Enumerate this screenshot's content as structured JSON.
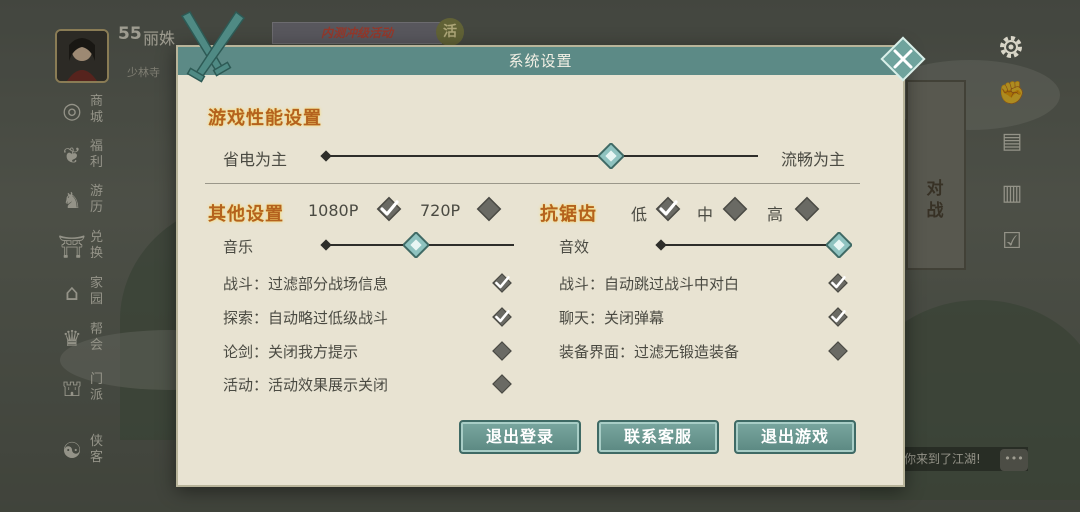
{
  "hud": {
    "level": "55",
    "name": "丽姝",
    "sub": "少林寺",
    "event_banner": "内测冲级活动",
    "event_badge": "活"
  },
  "left_menu": [
    {
      "label": "商城",
      "icon": "shop-icon"
    },
    {
      "label": "福利",
      "icon": "gift-icon"
    },
    {
      "label": "游历",
      "icon": "horse-icon"
    },
    {
      "label": "兑换",
      "icon": "exchange-icon"
    },
    {
      "label": "家园",
      "icon": "home-icon"
    },
    {
      "label": "帮会",
      "icon": "guild-icon"
    },
    {
      "label": "门派",
      "icon": "sect-icon"
    },
    {
      "label": "侠客",
      "icon": "hero-icon"
    }
  ],
  "scroll_banner": "对战",
  "chat": {
    "text": "你来到了江湖!"
  },
  "dialog": {
    "title": "系统设置",
    "performance": {
      "title": "游戏性能设置",
      "left_label": "省电为主",
      "right_label": "流畅为主",
      "value": 0.66
    },
    "other": {
      "title": "其他设置",
      "res_1080": {
        "label": "1080P",
        "checked": true
      },
      "res_720": {
        "label": "720P",
        "checked": false
      },
      "music": {
        "label": "音乐",
        "value": 0.48
      }
    },
    "aa": {
      "title": "抗锯齿",
      "low": {
        "label": "低",
        "checked": true
      },
      "mid": {
        "label": "中",
        "checked": false
      },
      "high": {
        "label": "高",
        "checked": false
      },
      "sfx": {
        "label": "音效",
        "value": 1.0
      }
    },
    "options_left": [
      {
        "label": "战斗：过滤部分战场信息",
        "checked": true
      },
      {
        "label": "探索：自动略过低级战斗",
        "checked": true
      },
      {
        "label": "论剑：关闭我方提示",
        "checked": false
      },
      {
        "label": "活动：活动效果展示关闭",
        "checked": false
      }
    ],
    "options_right": [
      {
        "label": "战斗：自动跳过战斗中对白",
        "checked": true
      },
      {
        "label": "聊天：关闭弹幕",
        "checked": true
      },
      {
        "label": "装备界面：过滤无锻造装备",
        "checked": false
      }
    ],
    "buttons": {
      "logout": "退出登录",
      "support": "联系客服",
      "exit": "退出游戏"
    }
  },
  "colors": {
    "panel_bg": "#e8e3d2",
    "titlebar": "#5c8a86",
    "section_title": "#b4621e",
    "thumb": "#8fc3c0",
    "check_on": "#ffffff",
    "check_box": "#6a6a64"
  }
}
